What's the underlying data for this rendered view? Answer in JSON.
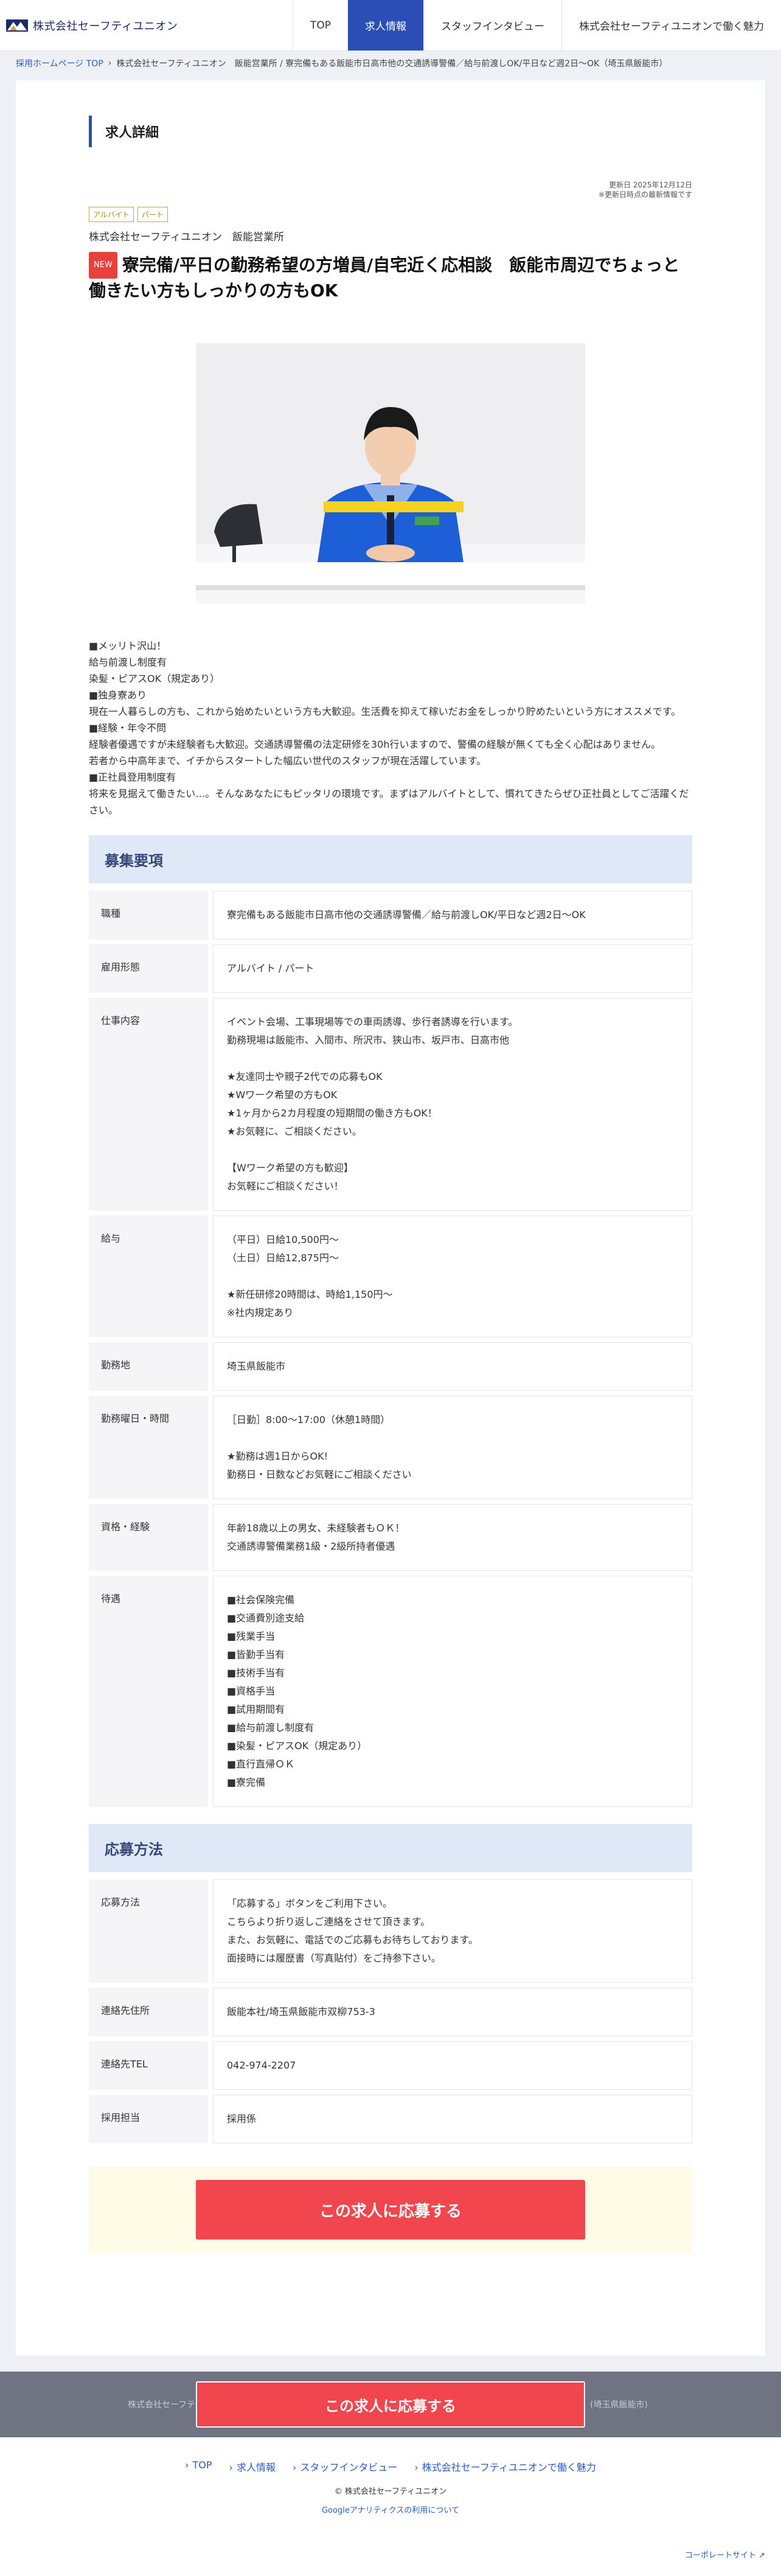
{
  "header": {
    "logo_text": "株式会社セーフティユニオン",
    "nav": [
      {
        "label": "TOP"
      },
      {
        "label": "求人情報"
      },
      {
        "label": "スタッフインタビュー"
      },
      {
        "label": "株式会社セーフティユニオンで働く魅力"
      }
    ]
  },
  "breadcrumb": {
    "home": "採用ホームページ TOP",
    "separator": "›",
    "current": "株式会社セーフティユニオン　飯能営業所 / 寮完備もある飯能市日高市他の交通誘導警備／給与前渡しOK/平日など週2日〜OK（埼玉県飯能市）"
  },
  "job": {
    "section_title": "求人詳細",
    "updated_line1": "更新日 2025年12月12日",
    "updated_line2": "※更新日時点の最新情報です",
    "tags": [
      "アルバイト",
      "パート"
    ],
    "company": "株式会社セーフティユニオン　飯能営業所",
    "new_badge": "NEW",
    "title": "寮完備/平日の勤務希望の方増員/自宅近く応相談　飯能市周辺でちょっと働きたい方もしっかりの方もOK",
    "intro": "■メッリト沢山！\n給与前渡し制度有\n染髪・ピアスOK（規定あり）\n■独身寮あり\n現在一人暮らしの方も、これから始めたいという方も大歓迎。生活費を抑えて稼いだお金をしっかり貯めたいという方にオススメです。\n■経験・年令不問\n経験者優遇ですが未経験者も大歓迎。交通誘導警備の法定研修を30h行いますので、警備の経験が無くても全く心配はありません。\n若者から中高年まで、イチからスタートした幅広い世代のスタッフが現在活躍しています。\n■正社員登用制度有\n将来を見据えて働きたい…。そんなあなたにもピッタリの環境です。まずはアルバイトとして、慣れてきたらぜひ正社員としてご活躍ください。"
  },
  "requirements": {
    "heading": "募集要項",
    "rows": [
      {
        "label": "職種",
        "value": "寮完備もある飯能市日高市他の交通誘導警備／給与前渡しOK/平日など週2日〜OK"
      },
      {
        "label": "雇用形態",
        "value": "アルバイト / パート"
      },
      {
        "label": "仕事内容",
        "value": "イベント会場、工事現場等での車両誘導、歩行者誘導を行います。\n勤務現場は飯能市、入間市、所沢市、狭山市、坂戸市、日高市他\n\n★友達同士や親子2代での応募もOK\n★Wワーク希望の方もOK\n★1ヶ月から2カ月程度の短期間の働き方もOK！\n★お気軽に、ご相談ください。\n\n【Wワーク希望の方も歓迎】\nお気軽にご相談ください！"
      },
      {
        "label": "給与",
        "value": "（平日）日給10,500円〜\n（土日）日給12,875円〜\n\n★新任研修20時間は、時給1,150円〜\n※社内規定あり"
      },
      {
        "label": "勤務地",
        "value": "埼玉県飯能市"
      },
      {
        "label": "勤務曜日・時間",
        "value": "［日勤］8:00〜17:00（休憩1時間）\n\n★勤務は週1日からOK!\n勤務日・日数などお気軽にご相談ください"
      },
      {
        "label": "資格・経験",
        "value": "年齢18歳以上の男女、未経験者もＯＫ！\n交通誘導警備業務1級・2級所持者優遇"
      },
      {
        "label": "待遇",
        "value": "■社会保険完備\n■交通費別途支給\n■残業手当\n■皆勤手当有\n■技術手当有\n■資格手当\n■試用期間有\n■給与前渡し制度有\n■染髪・ピアスOK（規定あり）\n■直行直帰ＯＫ\n■寮完備"
      }
    ]
  },
  "apply_method": {
    "heading": "応募方法",
    "rows": [
      {
        "label": "応募方法",
        "value": "「応募する」ボタンをご利用下さい。\nこちらより折り返しご連絡をさせて頂きます。\nまた、お気軽に、電話でのご応募もお待ちしております。\n面接時には履歴書（写真貼付）をご持参下さい。"
      },
      {
        "label": "連絡先住所",
        "value": "飯能本社/埼玉県飯能市双柳753-3"
      },
      {
        "label": "連絡先TEL",
        "value": "042-974-2207"
      },
      {
        "label": "採用担当",
        "value": "採用係"
      }
    ],
    "button": "この求人に応募する"
  },
  "sticky": {
    "left_text": "株式会社セーフテ",
    "right_text": "(埼玉県飯能市)",
    "button": "この求人に応募する"
  },
  "footer": {
    "links": [
      {
        "label": "TOP"
      },
      {
        "label": "求人情報"
      },
      {
        "label": "スタッフインタビュー"
      },
      {
        "label": "株式会社セーフティユニオンで働く魅力"
      }
    ],
    "link_marker": "›",
    "copyright": "© 株式会社セーフティユニオン",
    "ga": "Googleアナリティクスの利用について",
    "corp": "コーポレートサイト ↗"
  },
  "colors": {
    "brand": "#2a4eb5",
    "apply": "#f2464e",
    "req_head_bg": "#dfe8f7",
    "apply_bg": "#fffbe6",
    "new_badge": "#e8403a"
  }
}
